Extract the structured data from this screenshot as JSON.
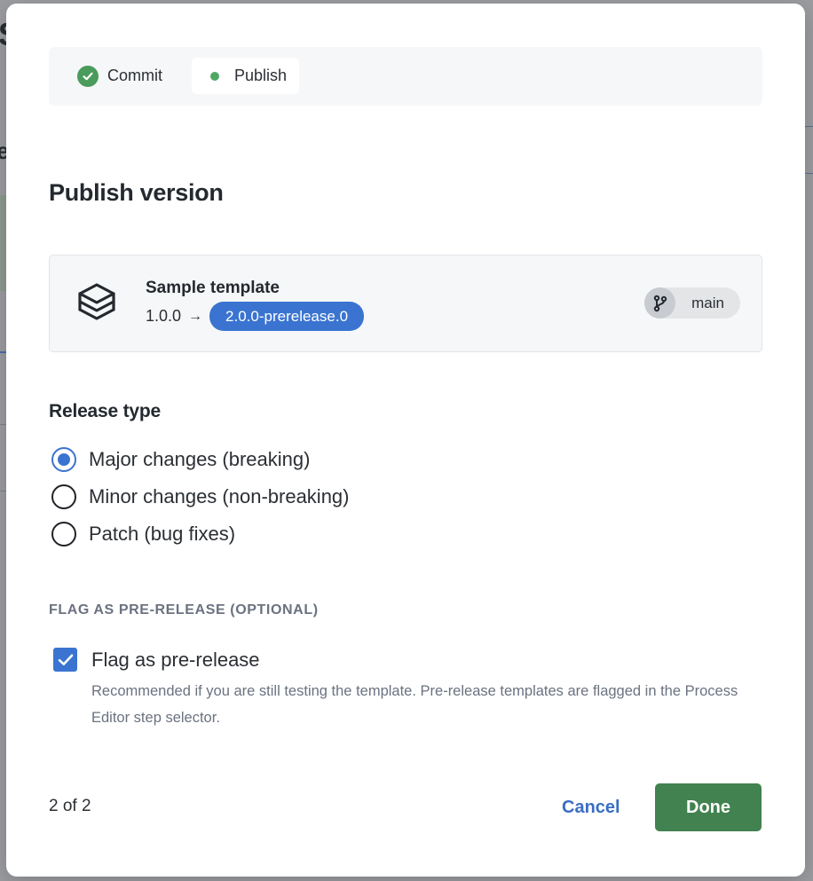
{
  "stepper": {
    "steps": [
      {
        "label": "Commit",
        "state": "complete"
      },
      {
        "label": "Publish",
        "state": "current"
      }
    ]
  },
  "dialog": {
    "title": "Publish version"
  },
  "template": {
    "name": "Sample template",
    "current_version": "1.0.0",
    "arrow": "→",
    "next_version": "2.0.0-prerelease.0",
    "branch": "main",
    "icon": "layers-icon"
  },
  "release_type": {
    "heading": "Release type",
    "options": [
      {
        "label": "Major changes (breaking)",
        "selected": true
      },
      {
        "label": "Minor changes (non-breaking)",
        "selected": false
      },
      {
        "label": "Patch (bug fixes)",
        "selected": false
      }
    ]
  },
  "prerelease": {
    "heading": "FLAG AS PRE-RELEASE (OPTIONAL)",
    "checkbox_label": "Flag as pre-release",
    "checked": true,
    "help_text": "Recommended if you are still testing the template. Pre-release templates are flagged in the Process Editor step selector."
  },
  "footer": {
    "counter": "2 of 2",
    "cancel_label": "Cancel",
    "done_label": "Done"
  },
  "colors": {
    "accent": "#3a74d0",
    "success": "#418250",
    "check_green": "#4a9b5c"
  }
}
